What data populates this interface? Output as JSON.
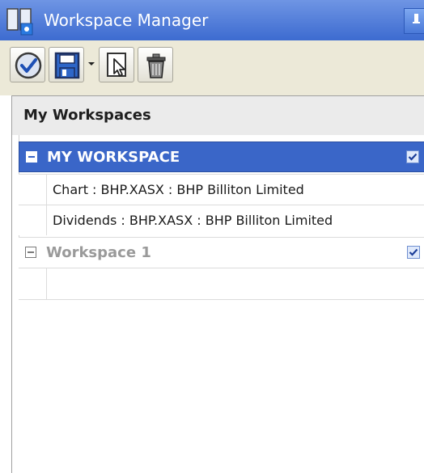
{
  "window": {
    "title": "Workspace Manager"
  },
  "toolbar": {
    "buttons": [
      {
        "icon": "checkmark-icon"
      },
      {
        "icon": "save-icon"
      },
      {
        "icon": "document-select-icon"
      },
      {
        "icon": "trash-icon"
      }
    ]
  },
  "panel": {
    "header": "My Workspaces",
    "workspaces": [
      {
        "title": "MY WORKSPACE",
        "selected": true,
        "checked": true,
        "items": [
          "Chart : BHP.XASX : BHP Billiton Limited",
          "Dividends : BHP.XASX : BHP Billiton Limited"
        ]
      },
      {
        "title": "Workspace 1",
        "selected": false,
        "checked": true,
        "items": []
      }
    ]
  },
  "colors": {
    "titlebar": "#3d6bd0",
    "selection": "#3a66c8",
    "toolbar_bg": "#ece9d8"
  }
}
